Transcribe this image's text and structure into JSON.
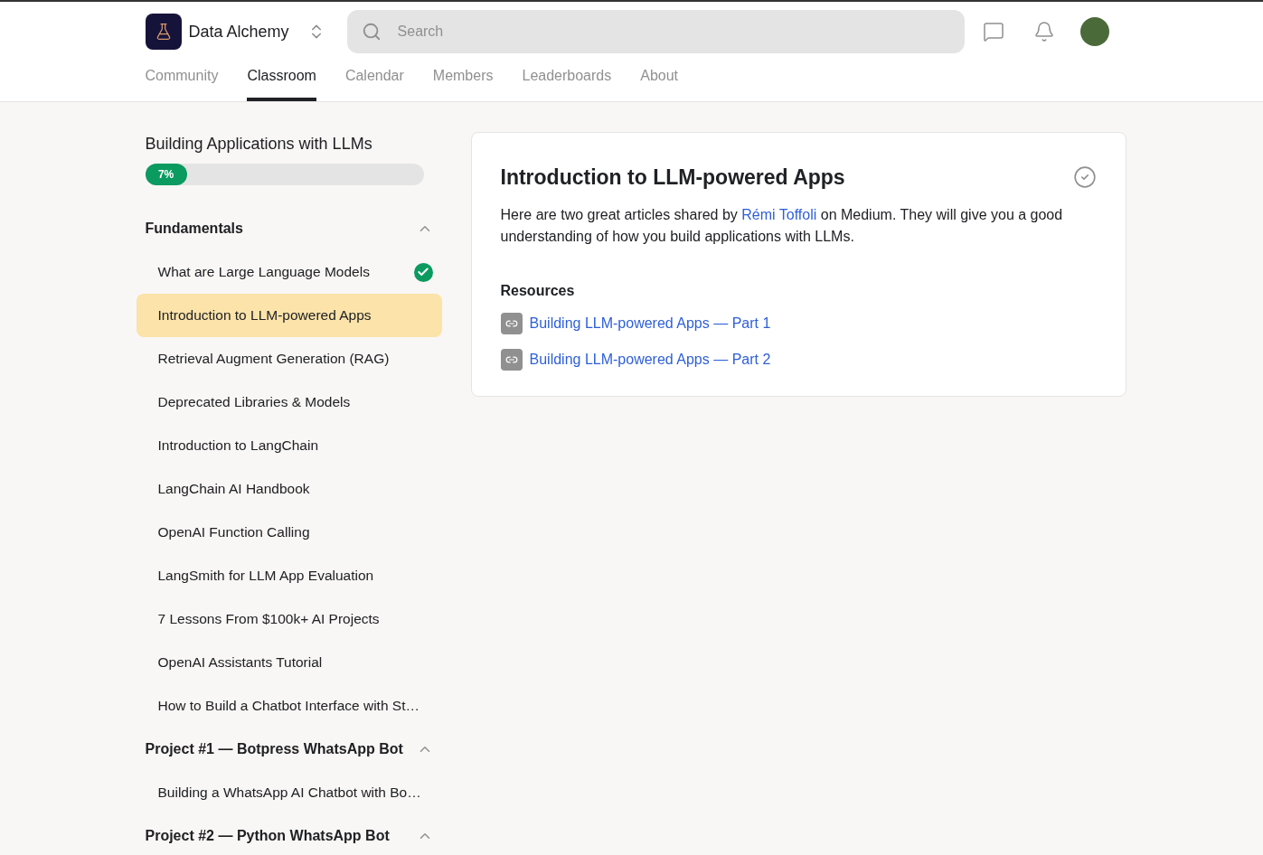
{
  "header": {
    "group_name": "Data Alchemy",
    "search": {
      "placeholder": "Search"
    }
  },
  "nav_tabs": [
    {
      "label": "Community",
      "selected": false
    },
    {
      "label": "Classroom",
      "selected": true
    },
    {
      "label": "Calendar",
      "selected": false
    },
    {
      "label": "Members",
      "selected": false
    },
    {
      "label": "Leaderboards",
      "selected": false
    },
    {
      "label": "About",
      "selected": false
    }
  ],
  "course": {
    "title": "Building Applications with LLMs",
    "progress_label": "7%",
    "level": 0.15
  },
  "sections": [
    {
      "title": "Fundamentals",
      "expanded": true,
      "lessons": [
        {
          "title": "What are Large Language Models",
          "completed": true,
          "selected": false
        },
        {
          "title": "Introduction to LLM-powered Apps",
          "completed": false,
          "selected": true
        },
        {
          "title": "Retrieval Augment Generation (RAG)",
          "completed": false,
          "selected": false
        },
        {
          "title": "Deprecated Libraries & Models",
          "completed": false,
          "selected": false
        },
        {
          "title": "Introduction to LangChain",
          "completed": false,
          "selected": false
        },
        {
          "title": "LangChain AI Handbook",
          "completed": false,
          "selected": false
        },
        {
          "title": "OpenAI Function Calling",
          "completed": false,
          "selected": false
        },
        {
          "title": "LangSmith for LLM App Evaluation",
          "completed": false,
          "selected": false
        },
        {
          "title": "7 Lessons From $100k+ AI Projects",
          "completed": false,
          "selected": false
        },
        {
          "title": "OpenAI Assistants Tutorial",
          "completed": false,
          "selected": false
        },
        {
          "title": "How to Build a Chatbot Interface with St…",
          "completed": false,
          "selected": false
        }
      ]
    },
    {
      "title": "Project #1 — Botpress WhatsApp Bot",
      "expanded": true,
      "lessons": [
        {
          "title": "Building a WhatsApp AI Chatbot with Bo…",
          "completed": false,
          "selected": false
        }
      ]
    },
    {
      "title": "Project #2 — Python WhatsApp Bot",
      "expanded": true
    }
  ],
  "lesson": {
    "title": "Introduction to LLM-powered Apps",
    "completed": false,
    "body": {
      "before": "Here are two great articles shared by",
      "link": "Rémi Toffoli",
      "after": "on Medium. They will give you a good understanding of how you build applications with LLMs."
    },
    "resources_heading": "Resources",
    "resources": [
      "Building LLM-powered Apps — Part 1",
      "Building LLM-powered Apps — Part 2"
    ]
  }
}
